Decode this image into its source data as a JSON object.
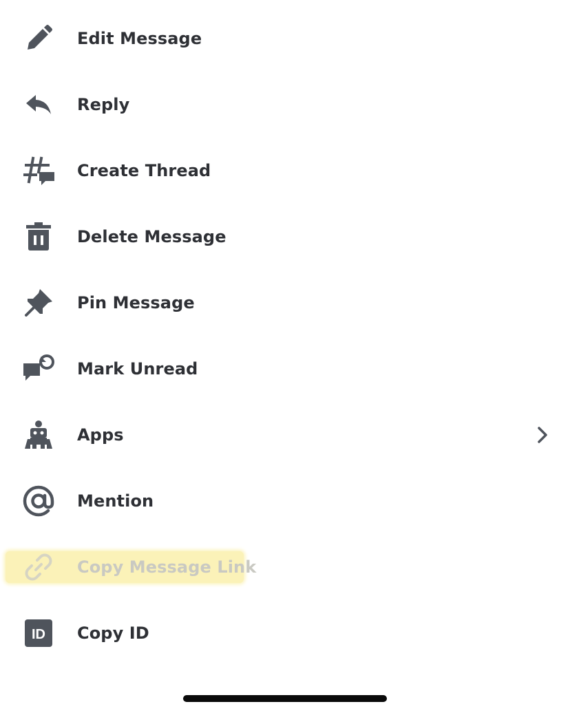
{
  "menu": {
    "items": [
      {
        "label": "Edit Message",
        "icon": "pencil-icon"
      },
      {
        "label": "Reply",
        "icon": "reply-arrow-icon"
      },
      {
        "label": "Create Thread",
        "icon": "thread-icon"
      },
      {
        "label": "Delete Message",
        "icon": "trash-icon"
      },
      {
        "label": "Pin Message",
        "icon": "pin-icon"
      },
      {
        "label": "Mark Unread",
        "icon": "mark-unread-icon"
      },
      {
        "label": "Apps",
        "icon": "robot-icon",
        "has_submenu": true
      },
      {
        "label": "Mention",
        "icon": "at-sign-icon"
      },
      {
        "label": "Copy Message Link",
        "icon": "link-icon",
        "highlighted": true
      },
      {
        "label": "Copy ID",
        "icon": "id-badge-icon",
        "badge_text": "ID"
      }
    ]
  },
  "colors": {
    "text": "#2e3035",
    "icon": "#4f545c",
    "highlight": "#fbf2b8",
    "disabled_text": "#c9c9c2"
  }
}
